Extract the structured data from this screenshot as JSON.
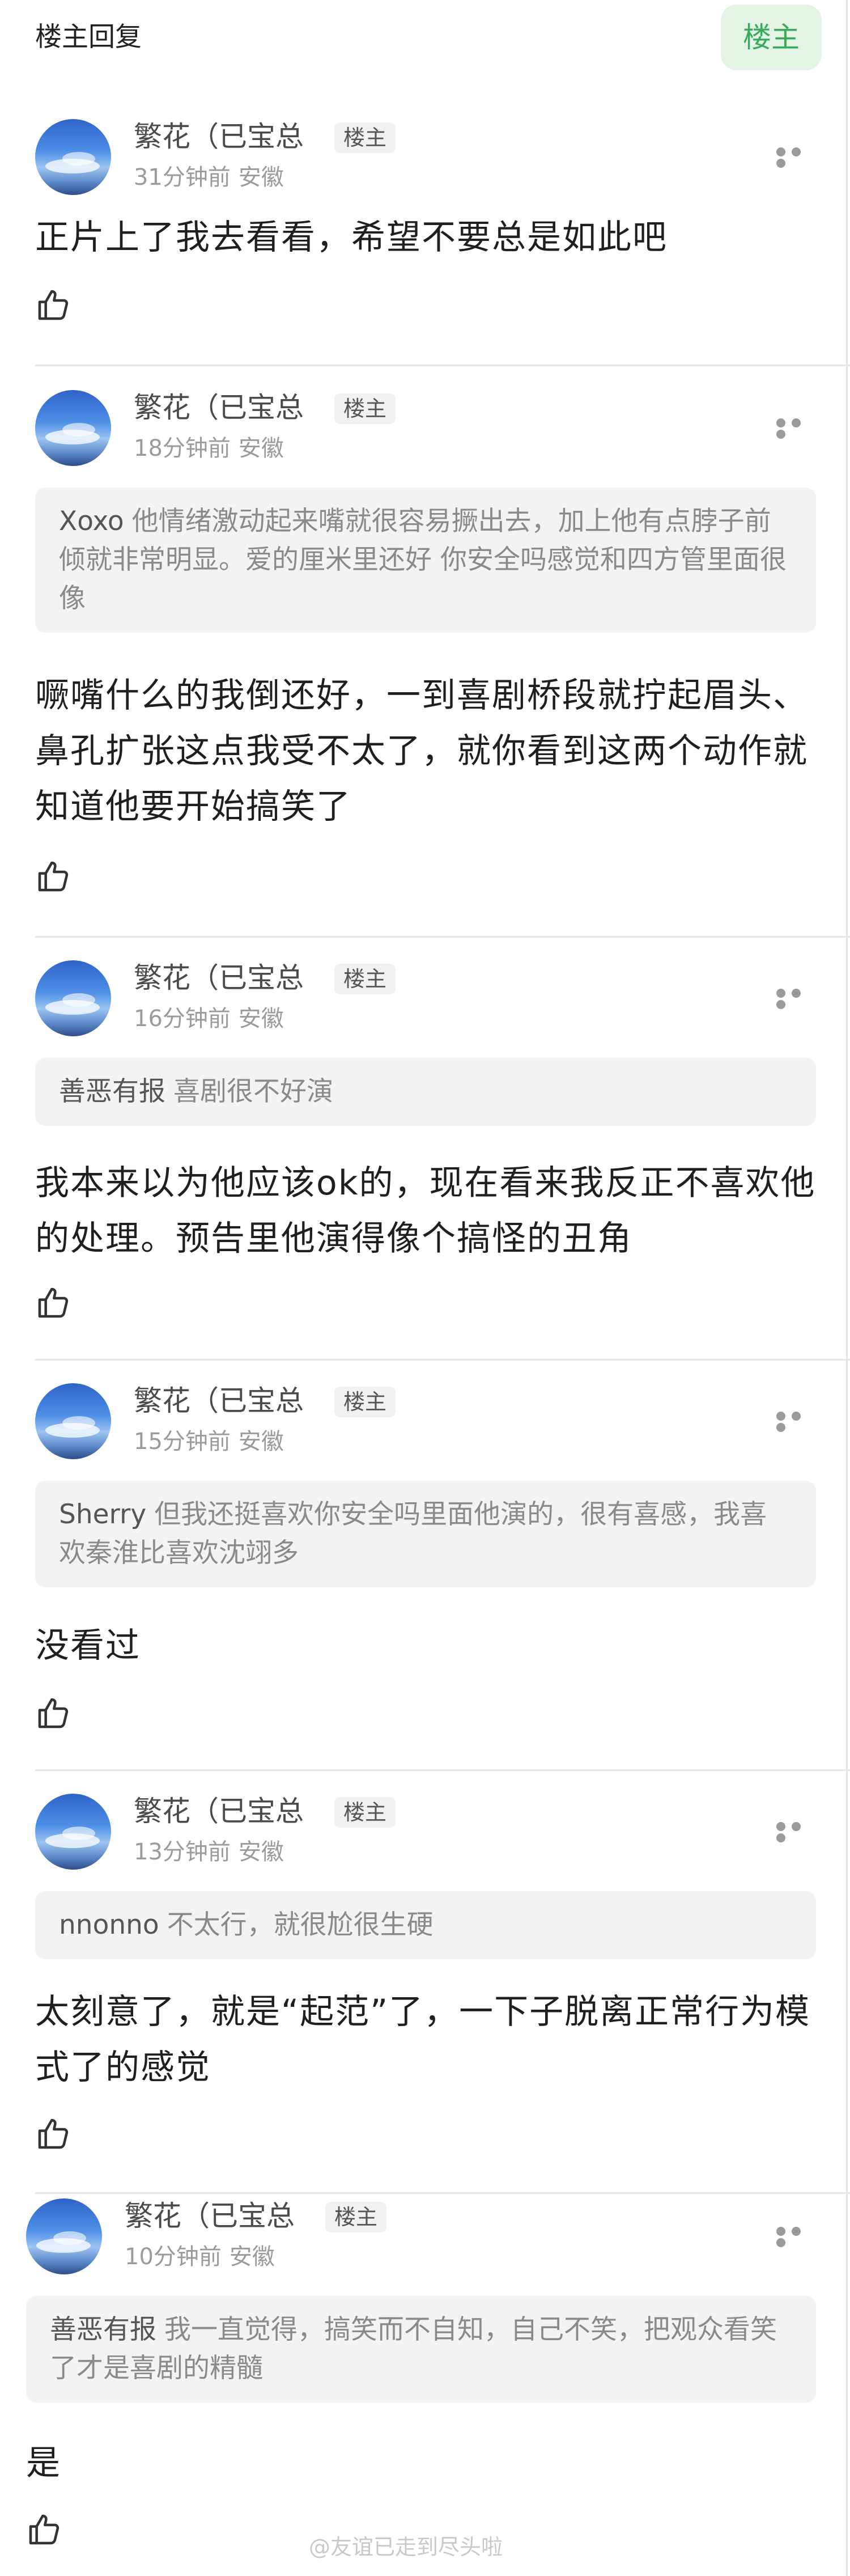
{
  "header": {
    "title": "楼主回复",
    "op_button": "楼主"
  },
  "posts": [
    {
      "author": "繁花（已宝总",
      "badge": "楼主",
      "time": "31分钟前",
      "location": "安徽",
      "quote": null,
      "text": "正片上了我去看看，希望不要总是如此吧"
    },
    {
      "author": "繁花（已宝总",
      "badge": "楼主",
      "time": "18分钟前",
      "location": "安徽",
      "quote": {
        "name": "Xoxo",
        "text": "他情绪激动起来嘴就很容易撅出去，加上他有点脖子前倾就非常明显。爱的厘米里还好 你安全吗感觉和四方管里面很像"
      },
      "text": "噘嘴什么的我倒还好，一到喜剧桥段就拧起眉头、鼻孔扩张这点我受不太了，就你看到这两个动作就知道他要开始搞笑了"
    },
    {
      "author": "繁花（已宝总",
      "badge": "楼主",
      "time": "16分钟前",
      "location": "安徽",
      "quote": {
        "name": "善恶有报",
        "text": "喜剧很不好演"
      },
      "text": "我本来以为他应该ok的，现在看来我反正不喜欢他的处理。预告里他演得像个搞怪的丑角"
    },
    {
      "author": "繁花（已宝总",
      "badge": "楼主",
      "time": "15分钟前",
      "location": "安徽",
      "quote": {
        "name": "Sherry",
        "text": "但我还挺喜欢你安全吗里面他演的，很有喜感，我喜欢秦淮比喜欢沈翊多"
      },
      "text": "没看过"
    },
    {
      "author": "繁花（已宝总",
      "badge": "楼主",
      "time": "13分钟前",
      "location": "安徽",
      "quote": {
        "name": "nnonno",
        "text": "不太行，就很尬很生硬"
      },
      "text": "太刻意了，就是“起范”了，一下子脱离正常行为模式了的感觉"
    },
    {
      "author": "繁花（已宝总",
      "badge": "楼主",
      "time": "10分钟前",
      "location": "安徽",
      "quote": {
        "name": "善恶有报",
        "text": "我一直觉得，搞笑而不自知，自己不笑，把观众看笑了才是喜剧的精髓"
      },
      "text": "是"
    }
  ],
  "watermark": "@友谊已走到尽头啦",
  "colors": {
    "accent": "#3aa95a",
    "accent_bg": "#e3f4e6",
    "quote_bg": "#f3f3f3"
  },
  "icons": {
    "like": "thumbs-up-icon",
    "more": "more-dots-icon"
  }
}
